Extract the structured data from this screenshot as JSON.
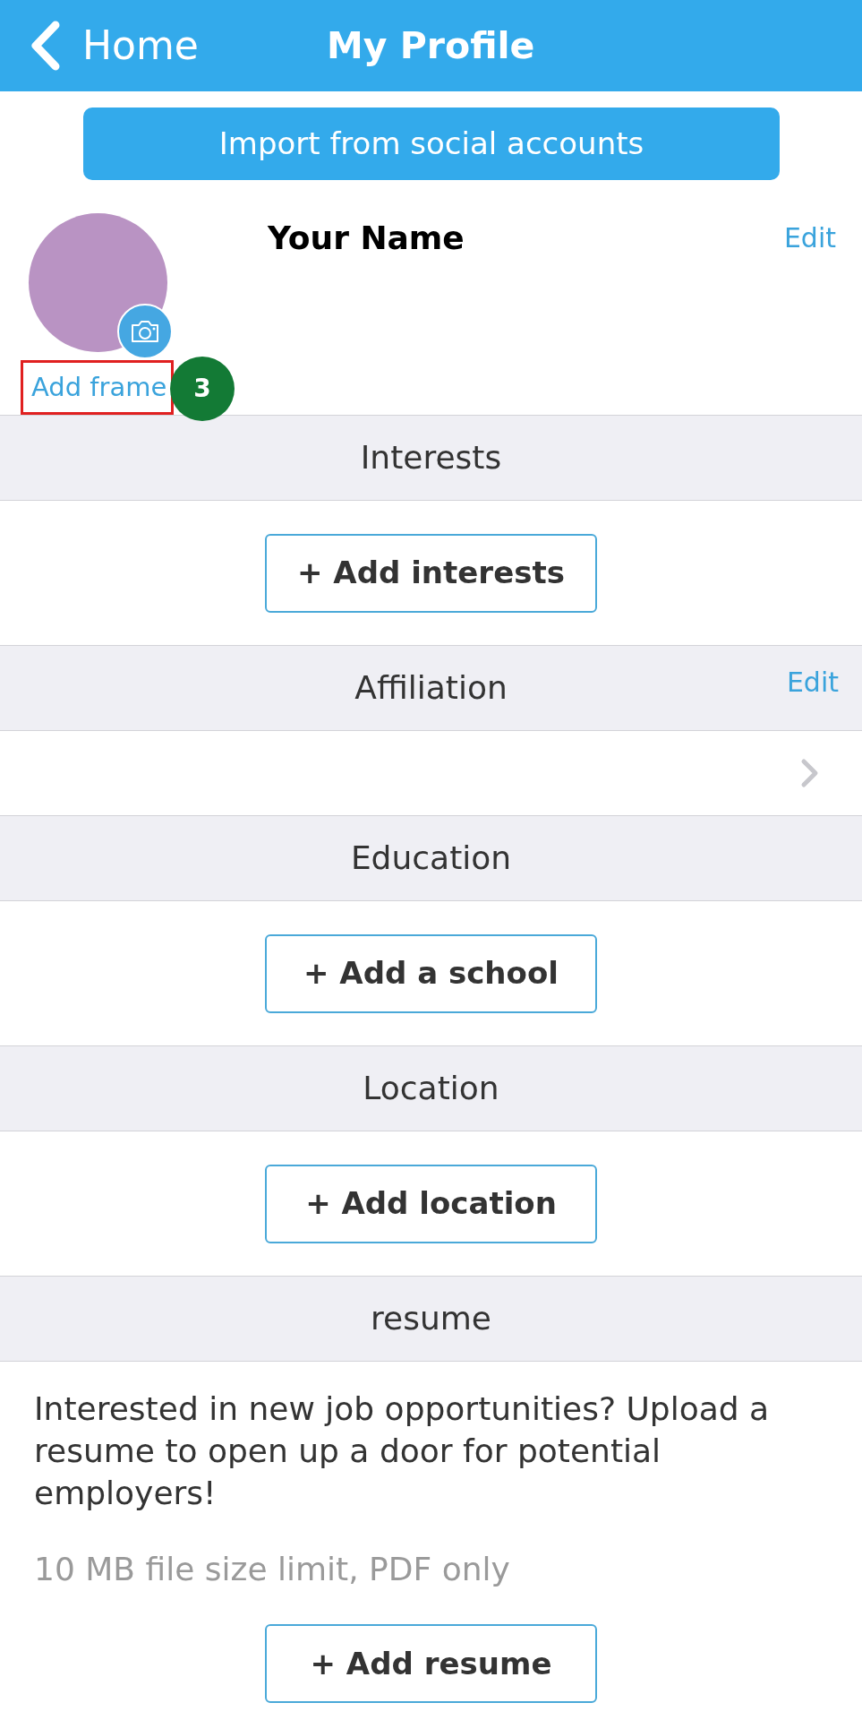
{
  "header": {
    "back_label": "Home",
    "title": "My Profile"
  },
  "import_button": {
    "label": "Import from social accounts"
  },
  "profile": {
    "name": "Your Name",
    "edit_label": "Edit",
    "add_frame_label": "Add frame"
  },
  "annotation": {
    "highlight": true,
    "step": "3"
  },
  "sections": [
    {
      "kind": "add_button",
      "title": "Interests",
      "button": "+ Add interests"
    },
    {
      "kind": "link_row",
      "title": "Affiliation",
      "edit_label": "Edit"
    },
    {
      "kind": "add_button",
      "title": "Education",
      "button": "+ Add a school"
    },
    {
      "kind": "add_button",
      "title": "Location",
      "button": "+ Add location"
    },
    {
      "kind": "resume",
      "title": "resume",
      "description": "Interested in new job opportunities? Upload a resume to open up a door for potential employers!",
      "note": "10 MB file size limit, PDF only",
      "button": "+ Add resume"
    }
  ]
}
